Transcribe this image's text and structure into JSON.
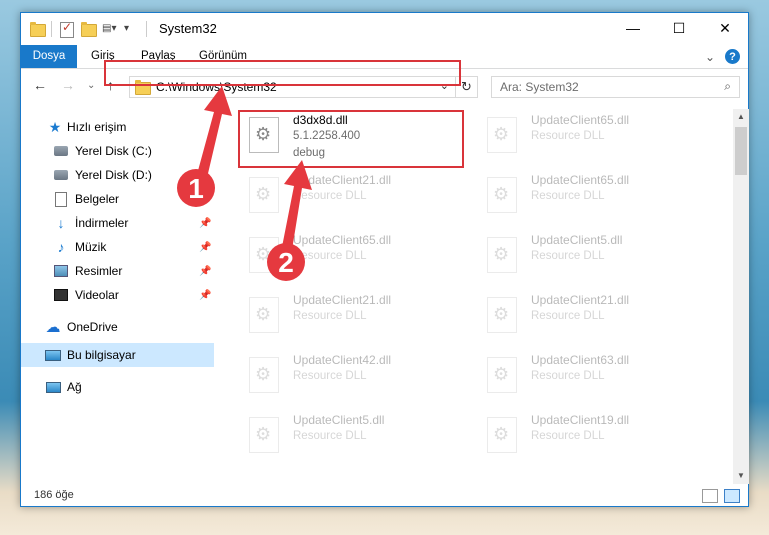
{
  "window": {
    "title": "System32",
    "buttons": {
      "minimize": "—",
      "maximize": "☐",
      "close": "✕"
    }
  },
  "ribbon": {
    "tabs": [
      "Dosya",
      "Giriş",
      "Paylaş",
      "Görünüm"
    ],
    "expand_glyph": "⌄",
    "help_glyph": "?"
  },
  "nav": {
    "back": "←",
    "forward": "→",
    "recent": "⌄",
    "up": "↑",
    "address": "C:\\Windows\\System32",
    "address_dropdown": "⌄",
    "refresh": "↻",
    "search_placeholder": "Ara: System32",
    "search_glyph": "⌕"
  },
  "sidebar": {
    "items": [
      {
        "label": "Hızlı erişim",
        "icon": "star-icon",
        "pinned": false
      },
      {
        "label": "Yerel Disk (C:)",
        "icon": "drive-icon",
        "pinned": false
      },
      {
        "label": "Yerel Disk (D:)",
        "icon": "drive-icon",
        "pinned": false
      },
      {
        "label": "Belgeler",
        "icon": "document-icon",
        "pinned": false
      },
      {
        "label": "İndirmeler",
        "icon": "download-icon",
        "pinned": true
      },
      {
        "label": "Müzik",
        "icon": "music-icon",
        "pinned": true
      },
      {
        "label": "Resimler",
        "icon": "pictures-icon",
        "pinned": true
      },
      {
        "label": "Videolar",
        "icon": "video-icon",
        "pinned": true
      },
      {
        "label": "OneDrive",
        "icon": "cloud-icon",
        "pinned": false
      },
      {
        "label": "Bu bilgisayar",
        "icon": "computer-icon",
        "pinned": false,
        "selected": true
      },
      {
        "label": "Ağ",
        "icon": "network-icon",
        "pinned": false
      }
    ],
    "pin_glyph": "📌"
  },
  "files": [
    {
      "name": "d3dx8d.dll",
      "line2": "5.1.2258.400",
      "line3": "debug",
      "faded": false
    },
    {
      "name": "UpdateClient65.dll",
      "line2": "Resource DLL",
      "faded": true
    },
    {
      "name": "UpdateClient21.dll",
      "line2": "Resource DLL",
      "faded": true
    },
    {
      "name": "UpdateClient65.dll",
      "line2": "Resource DLL",
      "faded": true
    },
    {
      "name": "UpdateClient65.dll",
      "line2": "Resource DLL",
      "faded": true
    },
    {
      "name": "UpdateClient5.dll",
      "line2": "Resource DLL",
      "faded": true
    },
    {
      "name": "UpdateClient21.dll",
      "line2": "Resource DLL",
      "faded": true
    },
    {
      "name": "UpdateClient21.dll",
      "line2": "Resource DLL",
      "faded": true
    },
    {
      "name": "UpdateClient42.dll",
      "line2": "Resource DLL",
      "faded": true
    },
    {
      "name": "UpdateClient63.dll",
      "line2": "Resource DLL",
      "faded": true
    },
    {
      "name": "UpdateClient5.dll",
      "line2": "Resource DLL",
      "faded": true
    },
    {
      "name": "UpdateClient19.dll",
      "line2": "Resource DLL",
      "faded": true
    }
  ],
  "status": {
    "count": "186 öğe"
  },
  "annotations": {
    "badge1": "1",
    "badge2": "2",
    "accent": "#d9343a"
  }
}
